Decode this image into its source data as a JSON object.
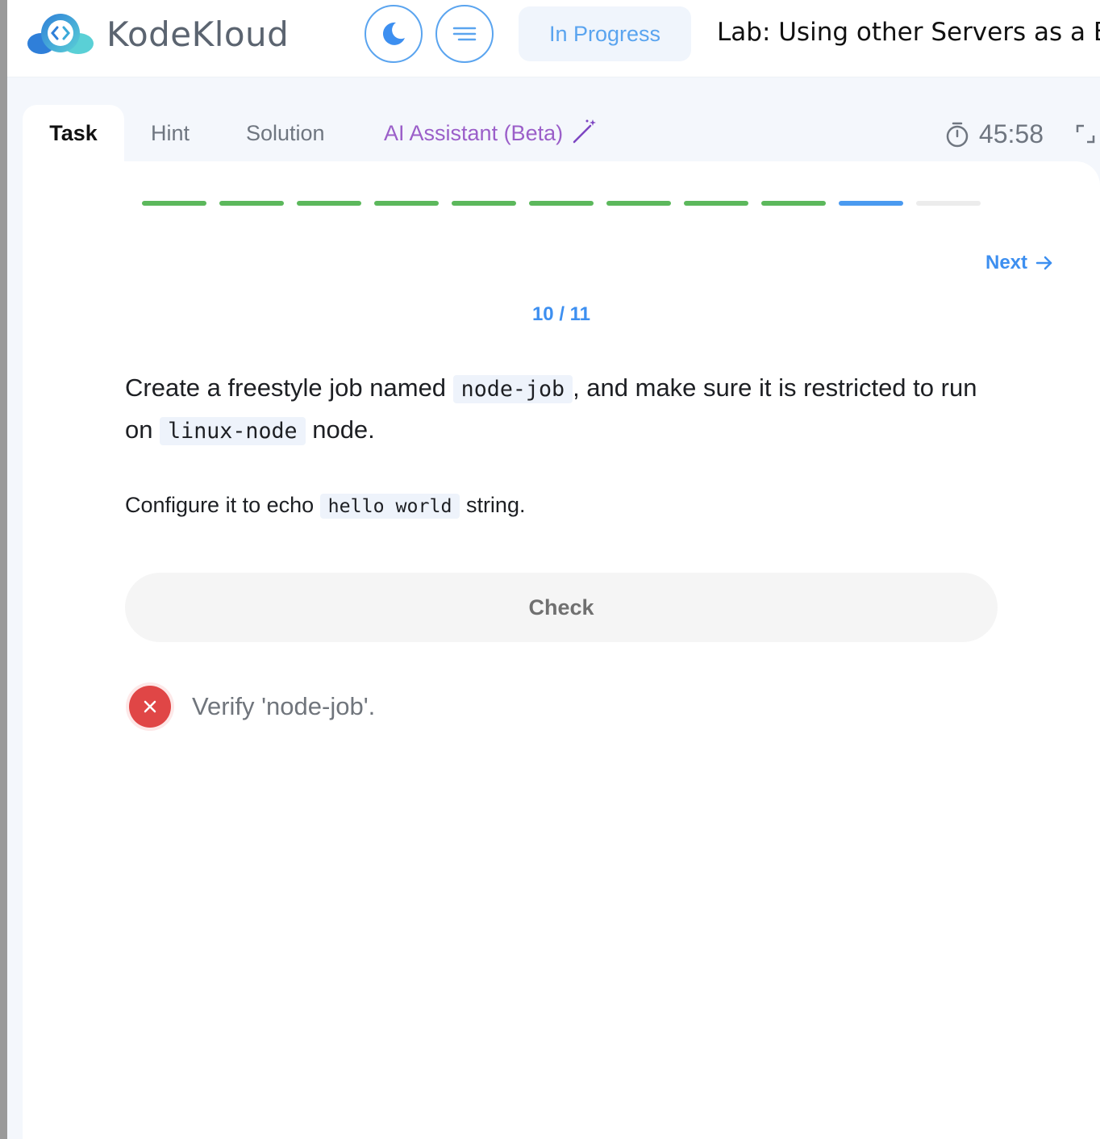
{
  "brand": {
    "name": "KodeKloud"
  },
  "header": {
    "status": "In Progress",
    "lab_title": "Lab: Using other Servers as a B"
  },
  "tabs": [
    {
      "label": "Task"
    },
    {
      "label": "Hint"
    },
    {
      "label": "Solution"
    },
    {
      "label": "AI Assistant (Beta)"
    }
  ],
  "timer": {
    "value": "45:58"
  },
  "colors": {
    "accent": "#3d8ff0",
    "done": "#5cb85c",
    "current": "#4a9af0",
    "pending": "#ececec",
    "error": "#e04646",
    "ai": "#9b5fc9"
  },
  "progress": {
    "segments": [
      "done",
      "done",
      "done",
      "done",
      "done",
      "done",
      "done",
      "done",
      "done",
      "current",
      "pending"
    ]
  },
  "nav": {
    "next_label": "Next"
  },
  "step": {
    "counter": "10 / 11"
  },
  "task": {
    "p1_a": "Create a freestyle job named ",
    "p1_code1": "node-job",
    "p1_b": ", and make sure it is restricted to run on ",
    "p1_code2": "linux-node",
    "p1_c": " node.",
    "p2_a": "Configure it to echo ",
    "p2_code": "hello world",
    "p2_b": " string."
  },
  "check": {
    "label": "Check"
  },
  "results": [
    {
      "status": "fail",
      "text": "Verify 'node-job'."
    }
  ]
}
